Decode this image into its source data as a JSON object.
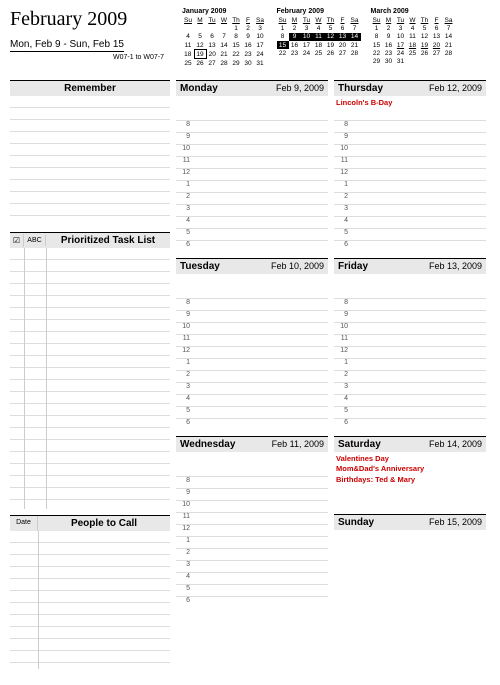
{
  "title": "February 2009",
  "week_range": "Mon, Feb 9  -  Sun, Feb 15",
  "week_codes": "W07-1 to W07-7",
  "minicals": [
    {
      "title": "January 2009",
      "dow": [
        "Su",
        "M",
        "Tu",
        "W",
        "Th",
        "F",
        "Sa"
      ],
      "rows": [
        [
          "",
          "",
          "",
          "",
          "1",
          "2",
          "3"
        ],
        [
          "4",
          "5",
          "6",
          "7",
          "8",
          "9",
          "10"
        ],
        [
          "11",
          "12",
          "13",
          "14",
          "15",
          "16",
          "17"
        ],
        [
          "18",
          "19",
          "20",
          "21",
          "22",
          "23",
          "24"
        ],
        [
          "25",
          "26",
          "27",
          "28",
          "29",
          "30",
          "31"
        ]
      ],
      "box": [
        3,
        1
      ]
    },
    {
      "title": "February 2009",
      "dow": [
        "Su",
        "M",
        "Tu",
        "W",
        "Th",
        "F",
        "Sa"
      ],
      "rows": [
        [
          "1",
          "2",
          "3",
          "4",
          "5",
          "6",
          "7"
        ],
        [
          "8",
          "9",
          "10",
          "11",
          "12",
          "13",
          "14"
        ],
        [
          "15",
          "16",
          "17",
          "18",
          "19",
          "20",
          "21"
        ],
        [
          "22",
          "23",
          "24",
          "25",
          "26",
          "27",
          "28"
        ],
        [
          "",
          "",
          "",
          "",
          "",
          "",
          ""
        ]
      ],
      "hl_row": 1,
      "hl_cols": [
        1,
        2,
        3,
        4,
        5,
        6
      ],
      "hl2": [
        2,
        0
      ]
    },
    {
      "title": "March 2009",
      "dow": [
        "Su",
        "M",
        "Tu",
        "W",
        "Th",
        "F",
        "Sa"
      ],
      "rows": [
        [
          "1",
          "2",
          "3",
          "4",
          "5",
          "6",
          "7"
        ],
        [
          "8",
          "9",
          "10",
          "11",
          "12",
          "13",
          "14"
        ],
        [
          "15",
          "16",
          "17",
          "18",
          "19",
          "20",
          "21"
        ],
        [
          "22",
          "23",
          "24",
          "25",
          "26",
          "27",
          "28"
        ],
        [
          "29",
          "30",
          "31",
          "",
          "",
          "",
          ""
        ]
      ],
      "under": [
        [
          2,
          2
        ],
        [
          2,
          3
        ],
        [
          2,
          4
        ],
        [
          2,
          5
        ]
      ]
    }
  ],
  "left": {
    "remember_title": "Remember",
    "task_icon": "☑",
    "task_abc": "ABC",
    "task_title": "Prioritized Task List",
    "people_date": "Date",
    "people_title": "People to Call"
  },
  "hours": [
    "8",
    "9",
    "10",
    "11",
    "12",
    "1",
    "2",
    "3",
    "4",
    "5",
    "6"
  ],
  "days": {
    "mon": {
      "name": "Monday",
      "date": "Feb 9, 2009",
      "events": []
    },
    "tue": {
      "name": "Tuesday",
      "date": "Feb 10, 2009",
      "events": []
    },
    "wed": {
      "name": "Wednesday",
      "date": "Feb 11, 2009",
      "events": []
    },
    "thu": {
      "name": "Thursday",
      "date": "Feb 12, 2009",
      "events": [
        "Lincoln's B-Day"
      ]
    },
    "fri": {
      "name": "Friday",
      "date": "Feb 13, 2009",
      "events": []
    },
    "sat": {
      "name": "Saturday",
      "date": "Feb 14, 2009",
      "events": [
        "Valentines Day",
        "Mom&Dad's Anniversary",
        "Birthdays: Ted & Mary"
      ]
    },
    "sun": {
      "name": "Sunday",
      "date": "Feb 15, 2009",
      "events": []
    }
  }
}
